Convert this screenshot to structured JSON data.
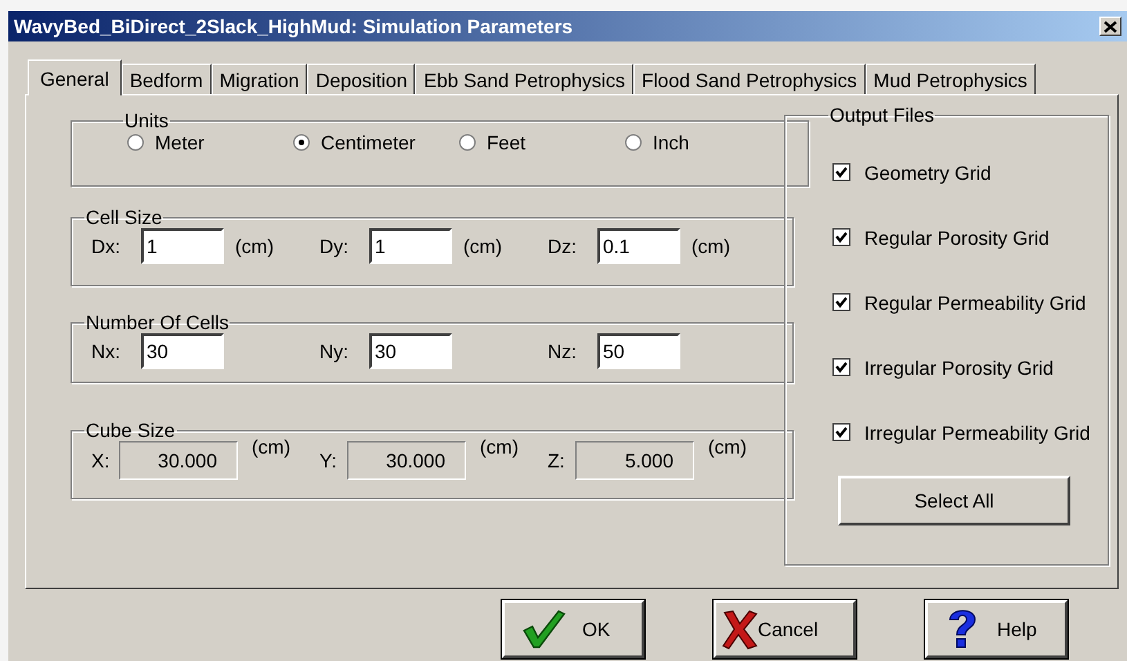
{
  "window": {
    "title": "WavyBed_BiDirect_2Slack_HighMud: Simulation Parameters"
  },
  "tabs": [
    {
      "label": "General",
      "selected": true
    },
    {
      "label": "Bedform",
      "selected": false
    },
    {
      "label": "Migration",
      "selected": false
    },
    {
      "label": "Deposition",
      "selected": false
    },
    {
      "label": "Ebb Sand Petrophysics",
      "selected": false
    },
    {
      "label": "Flood Sand Petrophysics",
      "selected": false
    },
    {
      "label": "Mud Petrophysics",
      "selected": false
    }
  ],
  "units": {
    "title": "Units",
    "options": [
      {
        "label": "Meter",
        "selected": false
      },
      {
        "label": "Centimeter",
        "selected": true
      },
      {
        "label": "Feet",
        "selected": false
      },
      {
        "label": "Inch",
        "selected": false
      }
    ]
  },
  "cell_size": {
    "title": "Cell Size",
    "fields": [
      {
        "label": "Dx:",
        "value": "1",
        "unit": "(cm)"
      },
      {
        "label": "Dy:",
        "value": "1",
        "unit": "(cm)"
      },
      {
        "label": "Dz:",
        "value": "0.1",
        "unit": "(cm)"
      }
    ]
  },
  "number_of_cells": {
    "title": "Number Of Cells",
    "fields": [
      {
        "label": "Nx:",
        "value": "30"
      },
      {
        "label": "Ny:",
        "value": "30"
      },
      {
        "label": "Nz:",
        "value": "50"
      }
    ]
  },
  "cube_size": {
    "title": "Cube Size",
    "fields": [
      {
        "label": "X:",
        "value": "30.000",
        "unit": "(cm)",
        "disabled": true
      },
      {
        "label": "Y:",
        "value": "30.000",
        "unit": "(cm)",
        "disabled": true
      },
      {
        "label": "Z:",
        "value": "5.000",
        "unit": "(cm)",
        "disabled": true
      }
    ]
  },
  "output_files": {
    "title": "Output Files",
    "items": [
      {
        "label": "Geometry Grid",
        "checked": true
      },
      {
        "label": "Regular Porosity Grid",
        "checked": true
      },
      {
        "label": "Regular Permeability Grid",
        "checked": true
      },
      {
        "label": "Irregular Porosity Grid",
        "checked": true
      },
      {
        "label": "Irregular Permeability Grid",
        "checked": true
      }
    ],
    "button": "Select All"
  },
  "buttons": [
    {
      "kind": "ok",
      "label": "OK"
    },
    {
      "kind": "cancel",
      "label": "Cancel"
    },
    {
      "kind": "help",
      "label": "Help"
    }
  ]
}
